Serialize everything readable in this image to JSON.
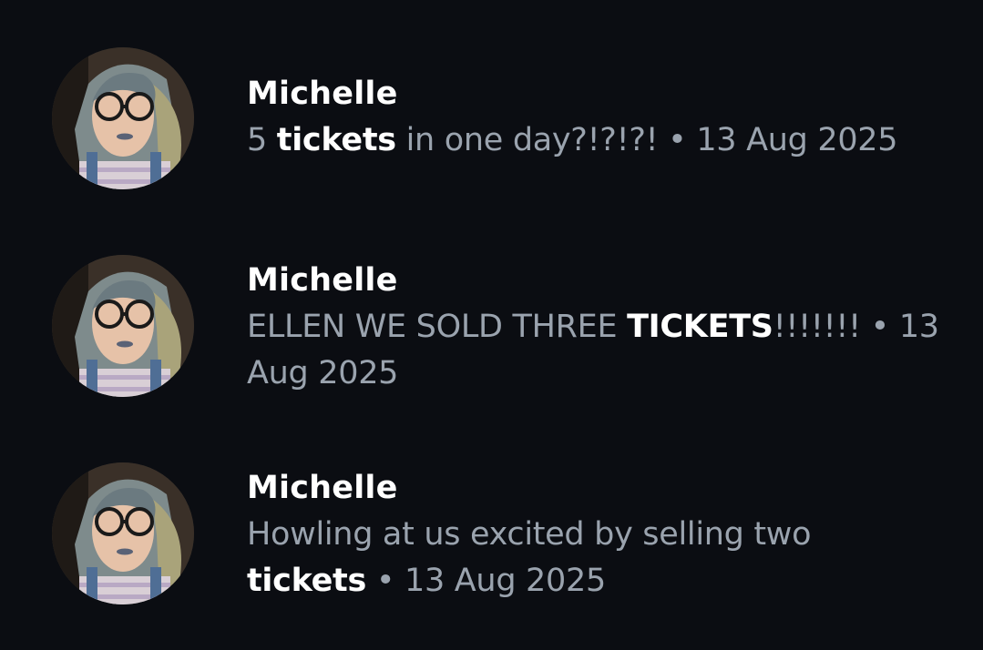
{
  "results": [
    {
      "name": "Michelle",
      "before": "5 ",
      "highlight": "tickets",
      "after": " in one day?!?!?! ",
      "separator": "•",
      "date": "13 Aug 2025"
    },
    {
      "name": "Michelle",
      "before": "ELLEN WE SOLD THREE ",
      "highlight": "TICKETS",
      "after": "!!!!!!! ",
      "separator": "•",
      "date": "13 Aug 2025"
    },
    {
      "name": "Michelle",
      "before": "Howling at us excited by selling two ",
      "highlight": "tickets",
      "after": " ",
      "separator": "•",
      "date": "13 Aug 2025"
    }
  ]
}
